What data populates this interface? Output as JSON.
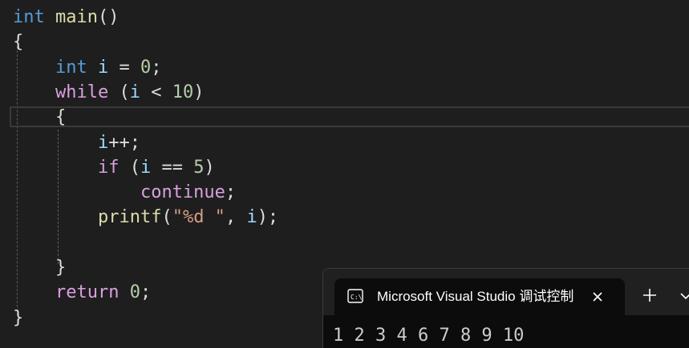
{
  "editor": {
    "lines": [
      [
        {
          "t": "int",
          "c": "kw"
        },
        {
          "t": " ",
          "c": "punct"
        },
        {
          "t": "main",
          "c": "fn"
        },
        {
          "t": "()",
          "c": "punct"
        }
      ],
      [
        {
          "t": "{",
          "c": "punct"
        }
      ],
      [
        {
          "t": "    ",
          "c": "punct"
        },
        {
          "t": "int",
          "c": "kw"
        },
        {
          "t": " ",
          "c": "punct"
        },
        {
          "t": "i",
          "c": "var"
        },
        {
          "t": " = ",
          "c": "op"
        },
        {
          "t": "0",
          "c": "num"
        },
        {
          "t": ";",
          "c": "punct"
        }
      ],
      [
        {
          "t": "    ",
          "c": "punct"
        },
        {
          "t": "while",
          "c": "ctl"
        },
        {
          "t": " (",
          "c": "punct"
        },
        {
          "t": "i",
          "c": "var"
        },
        {
          "t": " < ",
          "c": "op"
        },
        {
          "t": "10",
          "c": "num"
        },
        {
          "t": ")",
          "c": "punct"
        }
      ],
      [
        {
          "t": "    ",
          "c": "punct"
        },
        {
          "t": "{",
          "c": "punct"
        }
      ],
      [
        {
          "t": "        ",
          "c": "punct"
        },
        {
          "t": "i",
          "c": "var"
        },
        {
          "t": "++;",
          "c": "op"
        }
      ],
      [
        {
          "t": "        ",
          "c": "punct"
        },
        {
          "t": "if",
          "c": "ctl"
        },
        {
          "t": " (",
          "c": "punct"
        },
        {
          "t": "i",
          "c": "var"
        },
        {
          "t": " == ",
          "c": "op"
        },
        {
          "t": "5",
          "c": "num"
        },
        {
          "t": ")",
          "c": "punct"
        }
      ],
      [
        {
          "t": "            ",
          "c": "punct"
        },
        {
          "t": "continue",
          "c": "ctl"
        },
        {
          "t": ";",
          "c": "punct"
        }
      ],
      [
        {
          "t": "        ",
          "c": "punct"
        },
        {
          "t": "printf",
          "c": "fn"
        },
        {
          "t": "(",
          "c": "punct"
        },
        {
          "t": "\"%d \"",
          "c": "str"
        },
        {
          "t": ", ",
          "c": "punct"
        },
        {
          "t": "i",
          "c": "var"
        },
        {
          "t": ");",
          "c": "punct"
        }
      ],
      [],
      [
        {
          "t": "    ",
          "c": "punct"
        },
        {
          "t": "}",
          "c": "punct"
        }
      ],
      [
        {
          "t": "    ",
          "c": "punct"
        },
        {
          "t": "return",
          "c": "ctl"
        },
        {
          "t": " ",
          "c": "punct"
        },
        {
          "t": "0",
          "c": "num"
        },
        {
          "t": ";",
          "c": "punct"
        }
      ],
      [
        {
          "t": "}",
          "c": "punct"
        }
      ]
    ]
  },
  "terminal": {
    "tab_title": "Microsoft Visual Studio 调试控制台",
    "tab_icon": "console-icon",
    "close_icon": "close-icon",
    "new_tab_icon": "plus-icon",
    "dropdown_icon": "chevron-down-icon",
    "output": "1 2 3 4 6 7 8 9 10"
  },
  "colors": {
    "keyword": "#569cd6",
    "control": "#d8a0df",
    "function": "#dcdcaa",
    "variable": "#9cdcfe",
    "number": "#b5cea8",
    "string": "#d69d85",
    "background": "#1e1e1e"
  }
}
